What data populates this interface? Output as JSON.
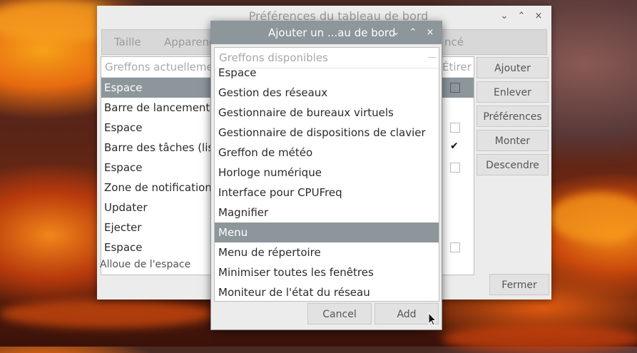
{
  "main_window": {
    "title": "Préférences du tableau de bord",
    "tabs": [
      "Taille",
      "Apparence",
      "ncé"
    ],
    "list_header": "Greffons actuellement",
    "stretch_header": "Étirer",
    "items": [
      {
        "label": "Espace",
        "stretch": false,
        "selected": true
      },
      {
        "label": "Barre de lancement d",
        "stretch": null,
        "selected": false
      },
      {
        "label": "Espace",
        "stretch": false,
        "selected": false
      },
      {
        "label": "Barre des tâches (liste",
        "stretch": true,
        "selected": false
      },
      {
        "label": "Espace",
        "stretch": false,
        "selected": false
      },
      {
        "label": "Zone de notification",
        "stretch": null,
        "selected": false
      },
      {
        "label": "Updater",
        "stretch": null,
        "selected": false
      },
      {
        "label": "Ejecter",
        "stretch": null,
        "selected": false
      },
      {
        "label": "Espace",
        "stretch": false,
        "selected": false
      }
    ],
    "status_text": "Alloue de l'espace",
    "buttons": {
      "add": "Ajouter",
      "remove": "Enlever",
      "preferences": "Préférences",
      "up": "Monter",
      "down": "Descendre",
      "close": "Fermer"
    }
  },
  "dialog": {
    "title": "Ajouter un ...au de bord",
    "list_header": "Greffons disponibles",
    "items": [
      "Espace",
      "Gestion des réseaux",
      "Gestionnaire de bureaux virtuels",
      "Gestionnaire de dispositions de clavier",
      "Greffon de météo",
      "Horloge numérique",
      "Interface pour CPUFreq",
      "Magnifier",
      "Menu",
      "Menu de répertoire",
      "Minimiser toutes les fenêtres",
      "Moniteur de l'état du réseau"
    ],
    "selected_item": "Menu",
    "buttons": {
      "cancel": "Cancel",
      "add": "Add"
    }
  },
  "window_controls": {
    "minimize": "⌄",
    "maximize": "⌃",
    "close": "×"
  },
  "colors": {
    "selection": "#8c969b",
    "dialog_titlebar": "#8c969b"
  }
}
